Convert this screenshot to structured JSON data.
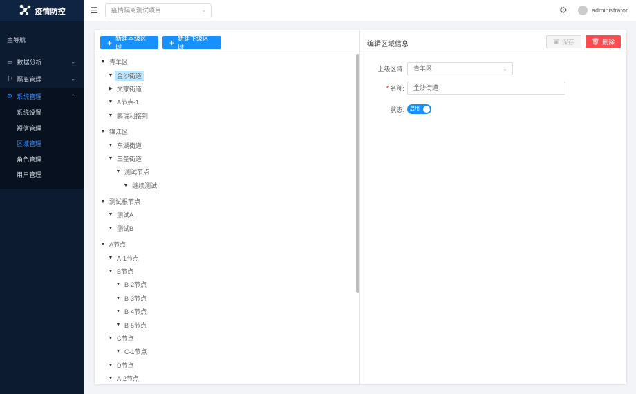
{
  "app": {
    "title": "疫情防控",
    "logo_icon": "molecule-icon"
  },
  "sidebar": {
    "heading": "主导航",
    "items": [
      {
        "label": "数据分析",
        "icon": "chart-board-icon"
      },
      {
        "label": "隔离管理",
        "icon": "flag-icon"
      },
      {
        "label": "系统管理",
        "icon": "gear-icon",
        "expanded": true,
        "children": [
          "系统设置",
          "短信管理",
          "区域管理",
          "角色管理",
          "用户管理"
        ],
        "active_child": "区域管理"
      }
    ]
  },
  "topbar": {
    "project": "疫情隔离测试项目",
    "user": "administrator"
  },
  "left": {
    "new_same_level": "新建本级区域",
    "new_child": "新建下级区域"
  },
  "tree": [
    {
      "label": "青羊区",
      "level": 0,
      "expanded": true
    },
    {
      "label": "金沙街道",
      "level": 1,
      "expanded": true,
      "selected": true
    },
    {
      "label": "文家街道",
      "level": 1,
      "expanded": false
    },
    {
      "label": "A节点-1",
      "level": 1,
      "expanded": true
    },
    {
      "label": "鹏瑞利接到",
      "level": 1,
      "expanded": true
    },
    {
      "label": "锦江区",
      "level": 0,
      "expanded": true
    },
    {
      "label": "东湖街道",
      "level": 1,
      "expanded": true
    },
    {
      "label": "三圣街道",
      "level": 1,
      "expanded": true
    },
    {
      "label": "测试节点",
      "level": 2,
      "expanded": true
    },
    {
      "label": "继续测试",
      "level": 3,
      "expanded": true
    },
    {
      "label": "测试根节点",
      "level": 0,
      "expanded": true
    },
    {
      "label": "测试A",
      "level": 1,
      "expanded": true
    },
    {
      "label": "测试B",
      "level": 1,
      "expanded": true
    },
    {
      "label": "A节点",
      "level": 0,
      "expanded": true
    },
    {
      "label": "A-1节点",
      "level": 1,
      "expanded": true
    },
    {
      "label": "B节点",
      "level": 1,
      "expanded": true
    },
    {
      "label": "B-2节点",
      "level": 2,
      "expanded": true
    },
    {
      "label": "B-3节点",
      "level": 2,
      "expanded": true
    },
    {
      "label": "B-4节点",
      "level": 2,
      "expanded": true
    },
    {
      "label": "B-5节点",
      "level": 2,
      "expanded": true
    },
    {
      "label": "C节点",
      "level": 1,
      "expanded": true
    },
    {
      "label": "C-1节点",
      "level": 2,
      "expanded": true
    },
    {
      "label": "D节点",
      "level": 1,
      "expanded": true
    },
    {
      "label": "A-2节点",
      "level": 1,
      "expanded": true
    }
  ],
  "form": {
    "title": "编辑区域信息",
    "save": "保存",
    "delete": "删除",
    "parent_label": "上级区域:",
    "parent_value": "青羊区",
    "name_label": "名称:",
    "name_value": "金沙街道",
    "status_label": "状态:",
    "status_value": "启用",
    "status_on": true
  },
  "colors": {
    "primary": "#1890ff",
    "danger": "#ff4d4f",
    "sidebar": "#0d1b30"
  }
}
